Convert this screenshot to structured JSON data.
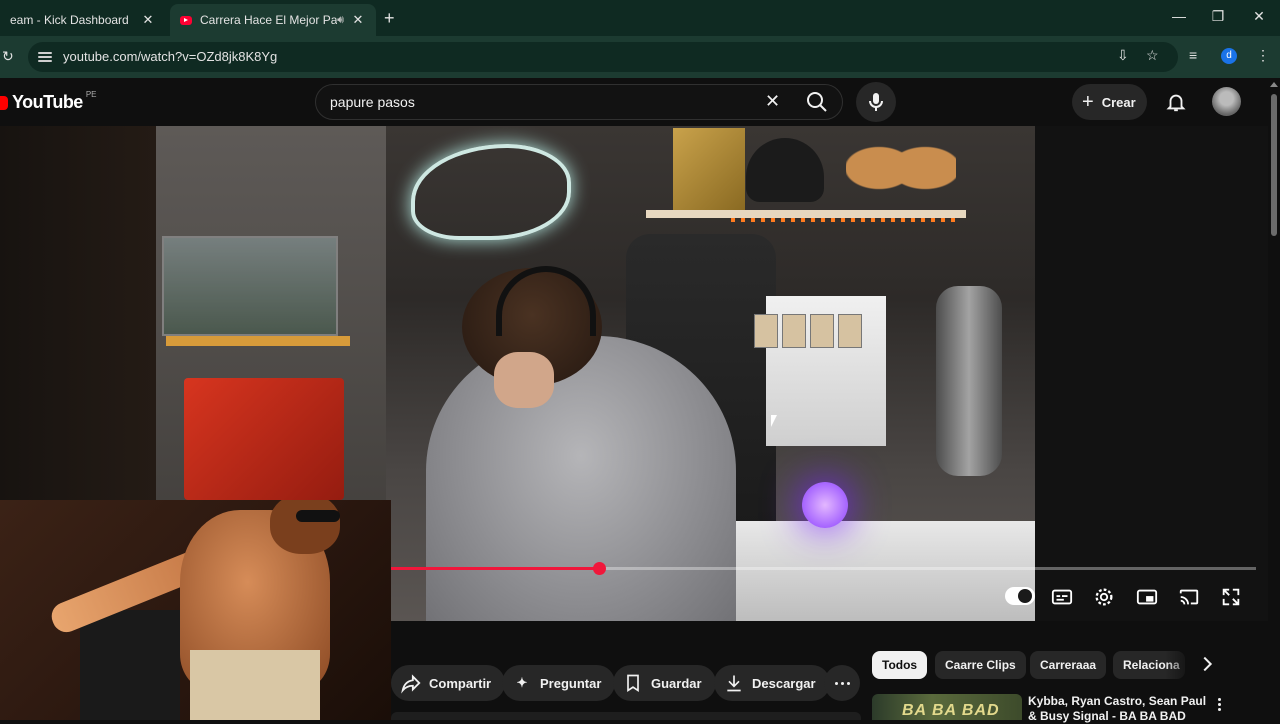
{
  "browser": {
    "tabs": [
      {
        "title": "eam - Kick Dashboard",
        "active": false
      },
      {
        "title": "Carrera Hace El Mejor Papu",
        "active": true
      }
    ],
    "url": "youtube.com/watch?v=OZd8jk8K8Yg",
    "profile_initial": "d"
  },
  "youtube": {
    "logo": {
      "wordmark": "YouTube",
      "country": "PE"
    },
    "search": {
      "query": "papure pasos"
    },
    "create_label": "Crear"
  },
  "player": {
    "progress_fraction": 0.241,
    "autoplay_on": true
  },
  "actions": {
    "share": "Compartir",
    "ask": "Preguntar",
    "save": "Guardar",
    "download": "Descargar"
  },
  "chips": [
    "Todos",
    "Caarre Clips",
    "Carreraaa",
    "Relaciona"
  ],
  "recommended": [
    {
      "title": "Kybba, Ryan Castro, Sean Paul & Busy Signal - BA BA BAD",
      "thumb_text": "BA BA BAD"
    }
  ],
  "colors": {
    "chrome_tab_bar": "#0f2a22",
    "chrome_toolbar": "#1c3b31",
    "yt_background": "#0f0f0f",
    "progress_red": "#f0173b",
    "youtube_red": "#ff0000"
  }
}
